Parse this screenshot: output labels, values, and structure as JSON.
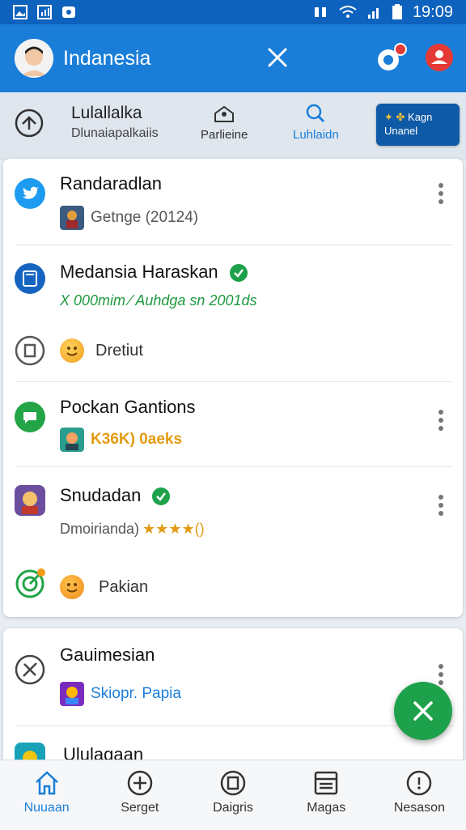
{
  "status_bar": {
    "time": "19:09",
    "icons": [
      "image-icon",
      "chart-icon",
      "message-icon",
      "vibrate-icon",
      "wifi-icon",
      "signal-icon",
      "battery-icon"
    ]
  },
  "app_bar": {
    "title": "Indanesia",
    "icons": [
      "avatar",
      "close-icon",
      "notifications-icon",
      "profile-icon"
    ],
    "accent": "#1a7ed9"
  },
  "toolbar": {
    "home_icon": "upload-home-icon",
    "group_title": "Lulallalka",
    "group_subtitle": "Dlunaiapalkaiis",
    "partners_label": "Parlieine",
    "search_label": "Luhlaidn",
    "cta_line1": "Kagn",
    "cta_line2": "Unanel"
  },
  "feed": {
    "items": [
      {
        "title": "Randaradlan",
        "subtitle": "Getnge (20124)",
        "icon": "twitter-bird-icon"
      },
      {
        "title": "Medansia Haraskan",
        "subtitle": "X 000mim ⁄ Auhdga sn 2001ds",
        "icon": "document-icon",
        "verified": true
      },
      {
        "title": "Dretiut",
        "icon": "archive-icon",
        "emoji": "smile-emoji-icon"
      },
      {
        "title": "Pockan Gantions",
        "subtitle": "K36K) 0aeks",
        "icon": "chat-icon"
      },
      {
        "title": "Snudadan",
        "subtitle": "Dmoirianda)",
        "rating_text": "★★★★()",
        "icon": "game-avatar-icon",
        "verified": true
      },
      {
        "title": "Pakian",
        "icon": "target-icon",
        "emoji": "smile-emoji-icon"
      }
    ],
    "card2_items": [
      {
        "title": "Gauimesian",
        "subtitle": "Skiopr. Papia",
        "icon": "tools-icon"
      },
      {
        "title": "Ululagaan",
        "icon": "game-icon"
      }
    ]
  },
  "fab": {
    "icon": "close-icon",
    "color": "#1ea14b"
  },
  "bottom_nav": {
    "items": [
      {
        "label": "Nuuaan",
        "icon": "home-icon",
        "active": true
      },
      {
        "label": "Serget",
        "icon": "add-circle-icon"
      },
      {
        "label": "Daigris",
        "icon": "tablet-icon"
      },
      {
        "label": "Magas",
        "icon": "inbox-icon"
      },
      {
        "label": "Nesason",
        "icon": "help-icon"
      }
    ]
  }
}
